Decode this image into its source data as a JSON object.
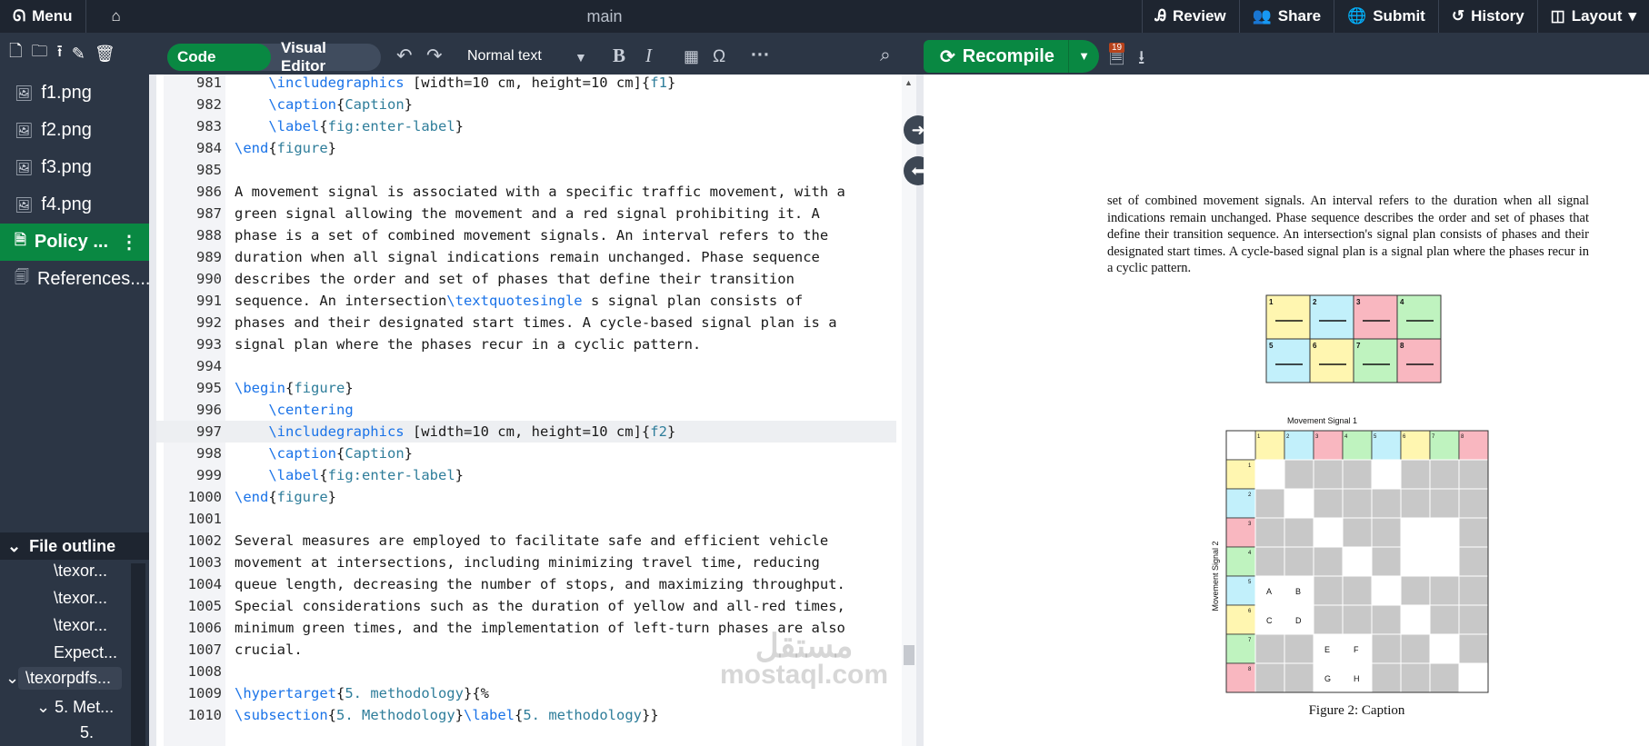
{
  "topbar": {
    "menu": "Menu",
    "title": "main",
    "review": "Review",
    "share": "Share",
    "submit": "Submit",
    "history": "History",
    "layout": "Layout"
  },
  "toolbar": {
    "code_editor": "Code Editor",
    "visual_editor": "Visual Editor",
    "text_style": "Normal text",
    "omega": "Ω",
    "recompile": "Recompile",
    "badge": "19"
  },
  "files": [
    {
      "name": "f1.png"
    },
    {
      "name": "f2.png"
    },
    {
      "name": "f3.png"
    },
    {
      "name": "f4.png"
    },
    {
      "name": "Policy ..."
    },
    {
      "name": "References...."
    }
  ],
  "outline": {
    "title": "File outline",
    "items": [
      "\\texor...",
      "\\texor...",
      "\\texor...",
      "Expect...",
      "\\texorpdfs...",
      "5. Met...",
      "5."
    ]
  },
  "editor": {
    "lines": [
      {
        "n": "981",
        "t": "    \\includegraphics [width=10 cm, height=10 cm]{f1}"
      },
      {
        "n": "982",
        "t": "    \\caption{Caption}"
      },
      {
        "n": "983",
        "t": "    \\label{fig:enter-label}"
      },
      {
        "n": "984",
        "t": "\\end{figure}"
      },
      {
        "n": "985",
        "t": ""
      },
      {
        "n": "986",
        "t": "A movement signal is associated with a specific traffic movement, with a"
      },
      {
        "n": "987",
        "t": "green signal allowing the movement and a red signal prohibiting it. A"
      },
      {
        "n": "988",
        "t": "phase is a set of combined movement signals. An interval refers to the"
      },
      {
        "n": "989",
        "t": "duration when all signal indications remain unchanged. Phase sequence"
      },
      {
        "n": "990",
        "t": "describes the order and set of phases that define their transition"
      },
      {
        "n": "991",
        "t": "sequence. An intersection\\textquotesingle s signal plan consists of"
      },
      {
        "n": "992",
        "t": "phases and their designated start times. A cycle-based signal plan is a"
      },
      {
        "n": "993",
        "t": "signal plan where the phases recur in a cyclic pattern."
      },
      {
        "n": "994",
        "t": ""
      },
      {
        "n": "995",
        "t": "\\begin{figure}"
      },
      {
        "n": "996",
        "t": "    \\centering"
      },
      {
        "n": "997",
        "t": "    \\includegraphics [width=10 cm, height=10 cm]{f2}"
      },
      {
        "n": "998",
        "t": "    \\caption{Caption}"
      },
      {
        "n": "999",
        "t": "    \\label{fig:enter-label}"
      },
      {
        "n": "1000",
        "t": "\\end{figure}"
      },
      {
        "n": "1001",
        "t": ""
      },
      {
        "n": "1002",
        "t": "Several measures are employed to facilitate safe and efficient vehicle"
      },
      {
        "n": "1003",
        "t": "movement at intersections, including minimizing travel time, reducing"
      },
      {
        "n": "1004",
        "t": "queue length, decreasing the number of stops, and maximizing throughput."
      },
      {
        "n": "1005",
        "t": "Special considerations such as the duration of yellow and all-red times,"
      },
      {
        "n": "1006",
        "t": "minimum green times, and the implementation of left-turn phases are also"
      },
      {
        "n": "1007",
        "t": "crucial."
      },
      {
        "n": "1008",
        "t": ""
      },
      {
        "n": "1009",
        "t": "\\hypertarget{5. methodology}{%"
      },
      {
        "n": "1010",
        "t": "\\subsection{5. Methodology}\\label{5. methodology}}"
      }
    ]
  },
  "pdf": {
    "paragraph": "set of combined movement signals. An interval refers to the duration when all signal indications remain unchanged. Phase sequence describes the order and set of phases that define their transition sequence. An intersection's signal plan consists of phases and their designated start times. A cycle-based signal plan is a signal plan where the phases recur in a cyclic pattern.",
    "grid_title": "Movement Signal 1",
    "grid_ylabel": "Movement Signal 2",
    "caption": "Figure 2: Caption",
    "cell_letters": [
      "A",
      "B",
      "C",
      "D",
      "E",
      "F",
      "G",
      "H"
    ],
    "tile_numbers": [
      "1",
      "2",
      "3",
      "4",
      "5",
      "6",
      "7",
      "8"
    ],
    "colors": {
      "yellow": "#fff6b0",
      "cyan": "#c2f0fb",
      "red": "#f9b7c0",
      "green": "#bff3bf",
      "gray": "#c8c8c8"
    }
  },
  "watermark": {
    "ar": "مستقل",
    "en": "mostaql.com"
  }
}
